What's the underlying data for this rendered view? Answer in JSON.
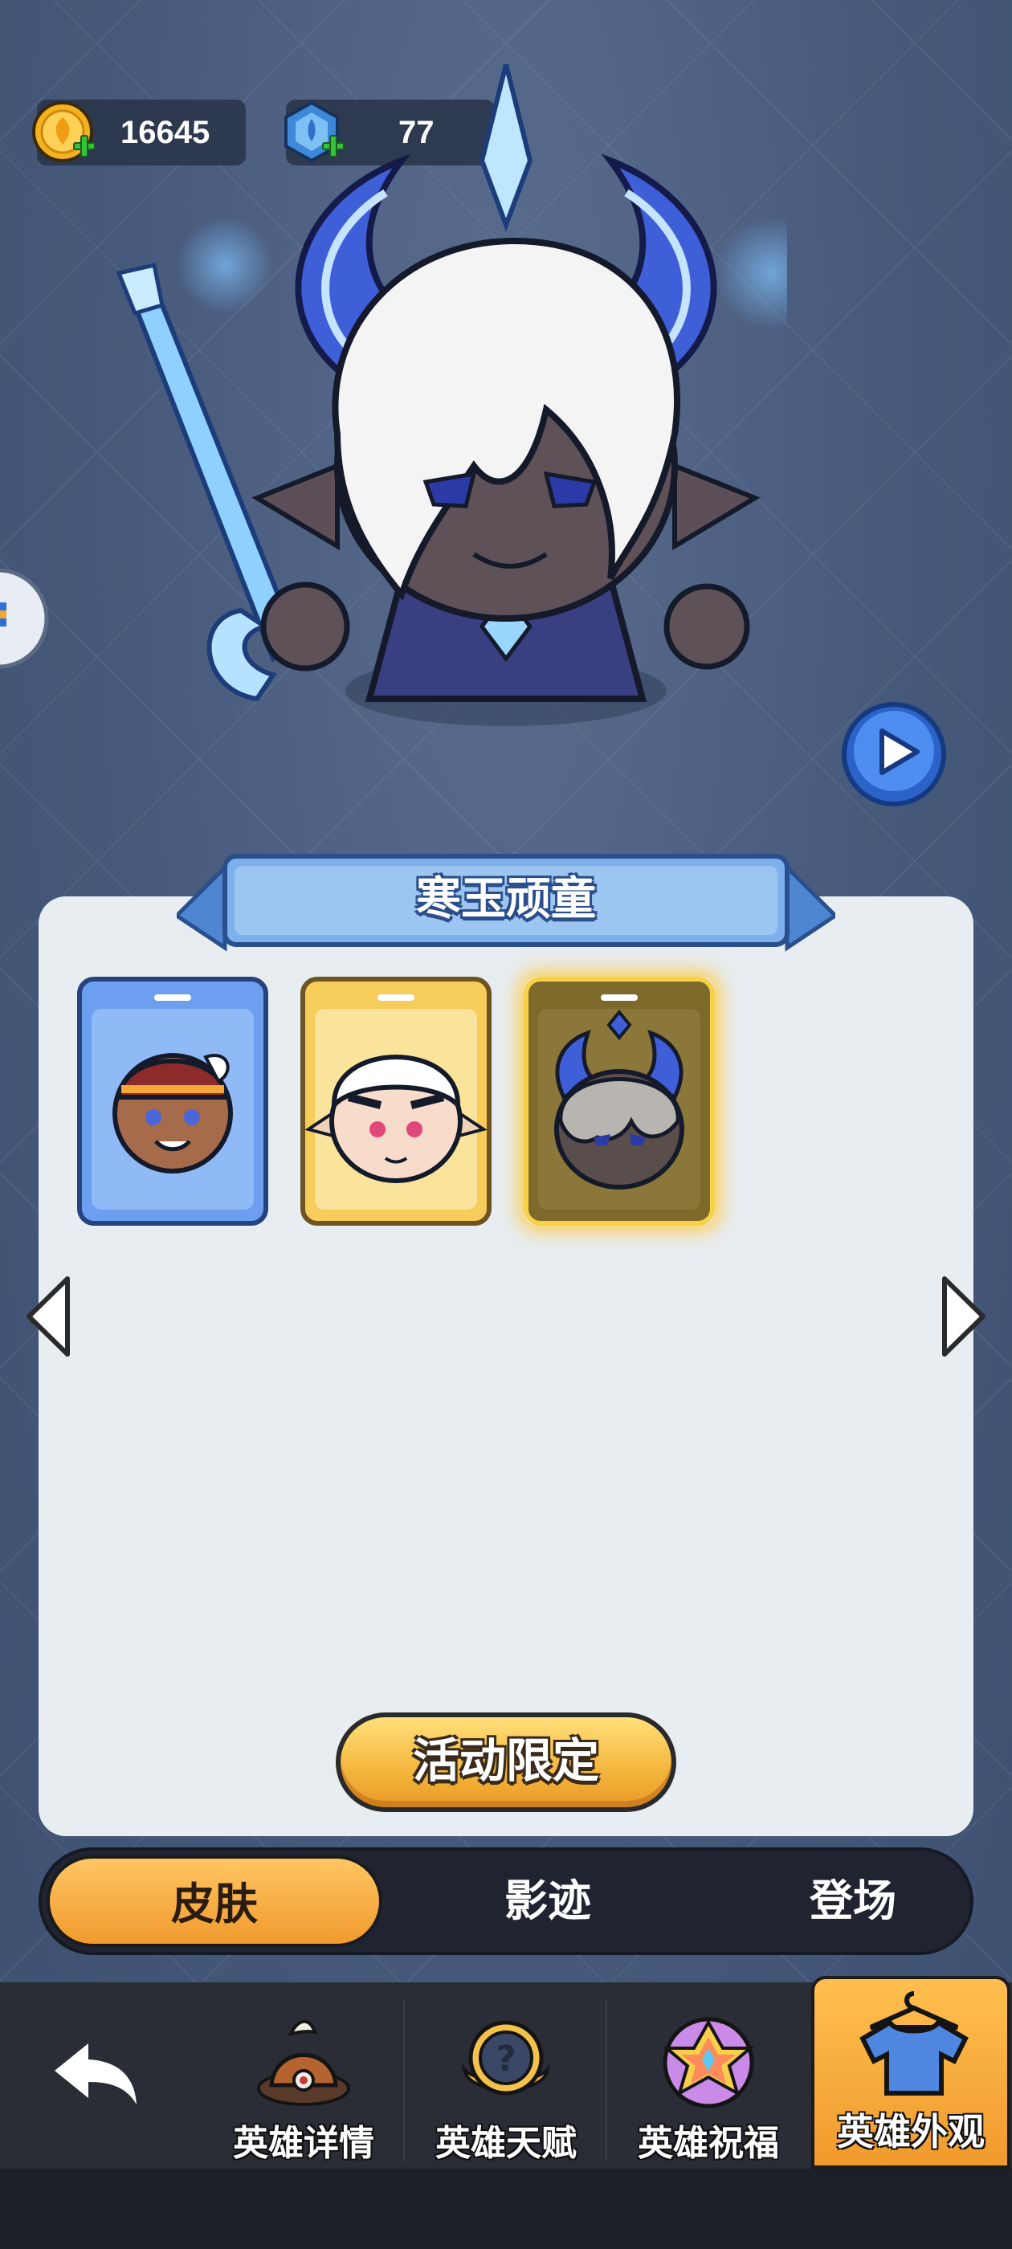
{
  "currency": {
    "gold": {
      "value": "16645",
      "icon": "gold-coin-plus-icon"
    },
    "gem": {
      "value": "77",
      "icon": "blue-gem-plus-icon"
    }
  },
  "hero": {
    "icon": "horned-hero-with-ice-spear"
  },
  "skin_panel": {
    "title": "寒玉顽童",
    "skins": [
      {
        "name": "feather-headband-skin",
        "frame": "#6d9ff0",
        "selected": false
      },
      {
        "name": "white-tiger-skin",
        "frame": "#f6cc5a",
        "selected": false
      },
      {
        "name": "frost-horn-skin",
        "frame": "#7d6a2a",
        "selected": true
      }
    ],
    "limited_button": "活动限定"
  },
  "tabs": {
    "active_index": 0,
    "items": [
      "皮肤",
      "影迹",
      "登场"
    ]
  },
  "bottom_nav": {
    "back_icon": "back-arrow-icon",
    "items": [
      {
        "label": "英雄详情",
        "icon": "hero-hat-icon"
      },
      {
        "label": "英雄天赋",
        "icon": "question-medal-icon"
      },
      {
        "label": "英雄祝福",
        "icon": "star-hexagram-icon"
      },
      {
        "label": "英雄外观",
        "icon": "tshirt-hanger-icon",
        "active": true
      }
    ]
  },
  "colors": {
    "accent": "#f4a837",
    "panel": "#e8edf1",
    "nav": "#2a2d36",
    "banner": "#5d93d8"
  }
}
